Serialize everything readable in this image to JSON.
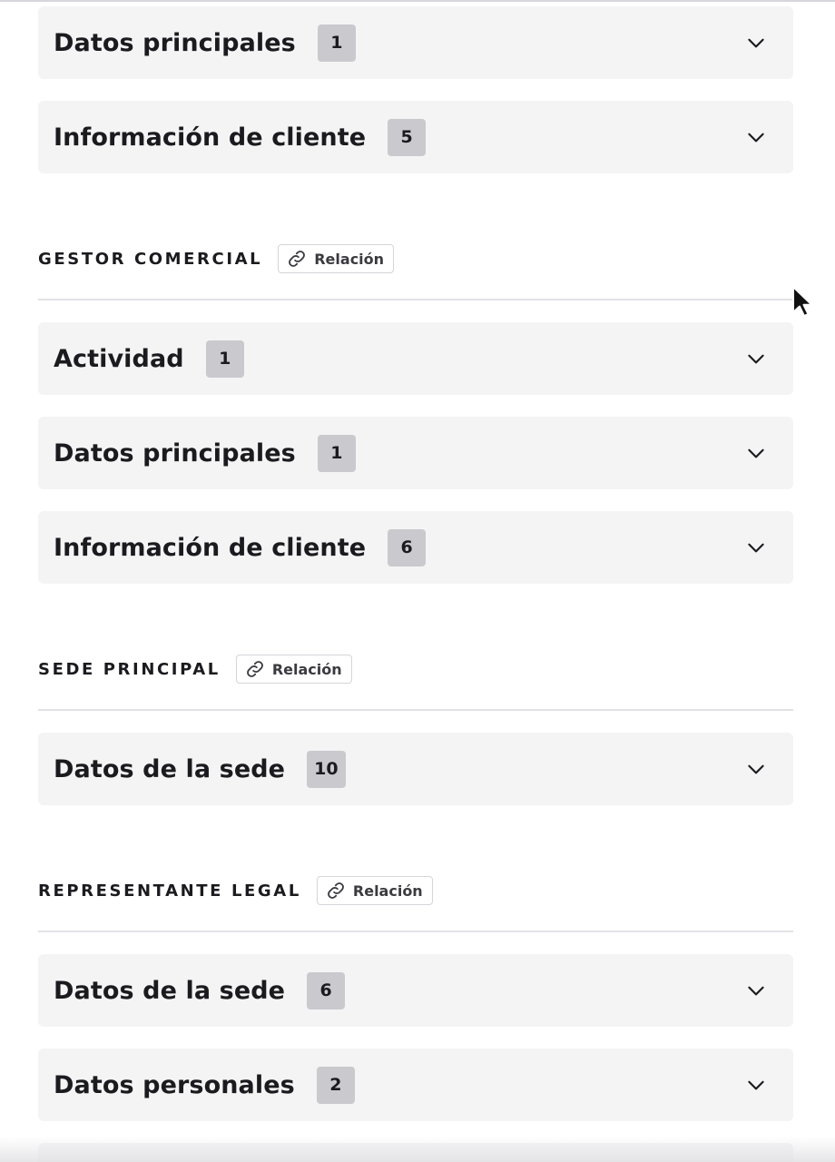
{
  "groups": [
    {
      "accordions": [
        {
          "title": "Datos principales",
          "count": "1"
        },
        {
          "title": "Información de cliente",
          "count": "5"
        }
      ]
    },
    {
      "section": {
        "label": "GESTOR COMERCIAL",
        "badge": "Relación"
      },
      "accordions": [
        {
          "title": "Actividad",
          "count": "1"
        },
        {
          "title": "Datos principales",
          "count": "1"
        },
        {
          "title": "Información de cliente",
          "count": "6"
        }
      ]
    },
    {
      "section": {
        "label": "SEDE PRINCIPAL",
        "badge": "Relación"
      },
      "accordions": [
        {
          "title": "Datos de la sede",
          "count": "10"
        }
      ]
    },
    {
      "section": {
        "label": "REPRESENTANTE LEGAL",
        "badge": "Relación"
      },
      "accordions": [
        {
          "title": "Datos de la sede",
          "count": "6"
        },
        {
          "title": "Datos personales",
          "count": "2"
        }
      ]
    }
  ],
  "icons": {
    "chevron": "chevron-down-icon",
    "relation": "link-icon",
    "pointer": "mouse-pointer-icon"
  },
  "colors": {
    "accordion_bg": "#f4f4f5",
    "count_badge_bg": "#c9c9ce",
    "text": "#1b1b1f",
    "divider": "#e2e2e6"
  }
}
